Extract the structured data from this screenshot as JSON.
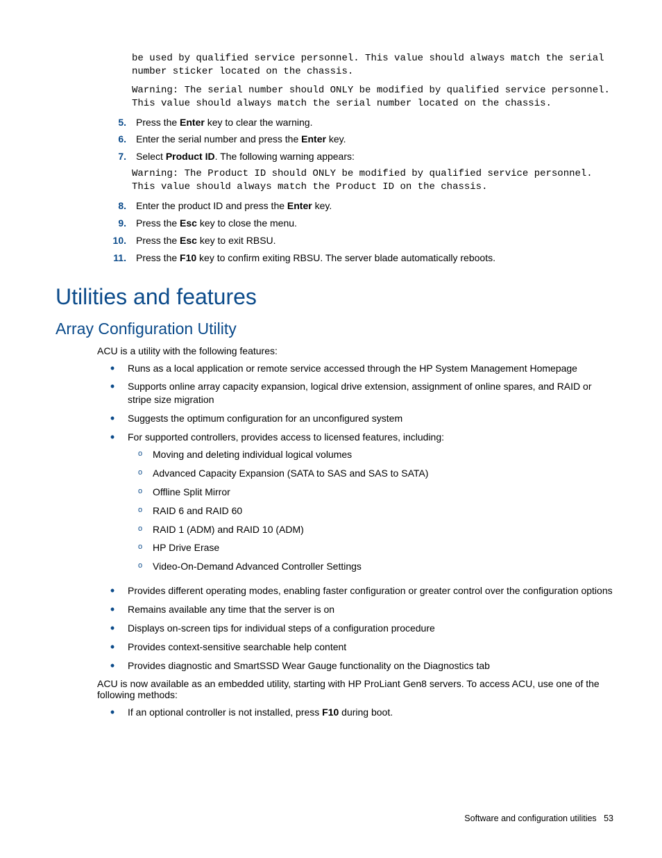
{
  "pre": {
    "p1": "be used by qualified service personnel. This value should always match the serial number sticker located on the chassis.",
    "p2": "Warning: The serial number should ONLY be modified by qualified service personnel. This value should always match the serial number located on the chassis."
  },
  "steps": [
    {
      "n": "5.",
      "pre": "Press the ",
      "bold": "Enter",
      "post": " key to clear the warning."
    },
    {
      "n": "6.",
      "pre": "Enter the serial number and press the ",
      "bold": "Enter",
      "post": " key."
    },
    {
      "n": "7.",
      "pre": "Select ",
      "bold": "Product ID",
      "post": ". The following warning appears:",
      "mono": "Warning: The Product ID should ONLY be modified by qualified service personnel. This value should always match the Product ID on the chassis."
    },
    {
      "n": "8.",
      "pre": "Enter the product ID and press the ",
      "bold": "Enter",
      "post": " key."
    },
    {
      "n": "9.",
      "pre": "Press the ",
      "bold": "Esc",
      "post": " key to close the menu."
    },
    {
      "n": "10.",
      "pre": "Press the ",
      "bold": "Esc",
      "post": " key to exit RBSU."
    },
    {
      "n": "11.",
      "pre": "Press the ",
      "bold": "F10",
      "post": " key to confirm exiting RBSU. The server blade automatically reboots."
    }
  ],
  "h1": "Utilities and features",
  "h2": "Array Configuration Utility",
  "acu_intro": "ACU is a utility with the following features:",
  "features": [
    {
      "t": "Runs as a local application or remote service accessed through the HP System Management Homepage"
    },
    {
      "t": "Supports online array capacity expansion, logical drive extension, assignment of online spares, and RAID or stripe size migration"
    },
    {
      "t": "Suggests the optimum configuration for an unconfigured system"
    },
    {
      "t": "For supported controllers, provides access to licensed features, including:",
      "sub": [
        "Moving and deleting individual logical volumes",
        "Advanced Capacity Expansion (SATA to SAS and SAS to SATA)",
        "Offline Split Mirror",
        "RAID 6 and RAID 60",
        "RAID 1 (ADM) and RAID 10 (ADM)",
        "HP Drive Erase",
        "Video-On-Demand Advanced Controller Settings"
      ]
    },
    {
      "t": "Provides different operating modes, enabling faster configuration or greater control over the configuration options"
    },
    {
      "t": "Remains available any time that the server is on"
    },
    {
      "t": "Displays on-screen tips for individual steps of a configuration procedure"
    },
    {
      "t": "Provides context-sensitive searchable help content"
    },
    {
      "t": "Provides diagnostic and SmartSSD Wear Gauge functionality on the Diagnostics tab"
    }
  ],
  "acu_outro": "ACU is now available as an embedded utility, starting with HP ProLiant Gen8 servers. To access ACU, use one of the following methods:",
  "methods": [
    {
      "pre": "If an optional controller is not installed, press ",
      "bold": "F10",
      "post": " during boot."
    }
  ],
  "footer": {
    "label": "Software and configuration utilities",
    "page": "53"
  }
}
